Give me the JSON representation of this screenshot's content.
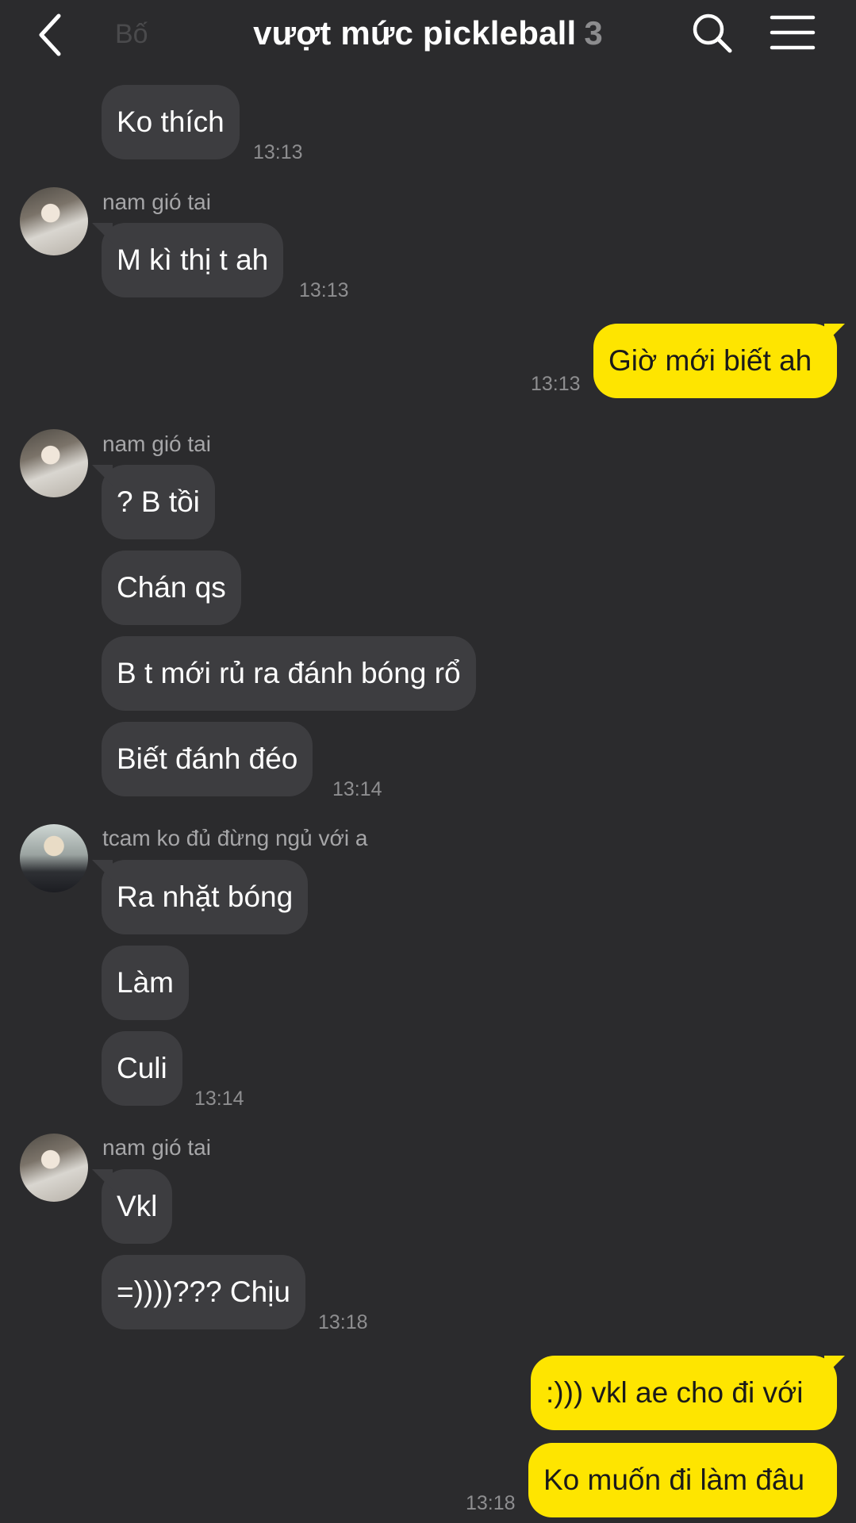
{
  "header": {
    "ghost_name": "Bố",
    "title": "vượt mức pickleball",
    "member_count": "3"
  },
  "colors": {
    "background": "#2b2b2d",
    "incoming_bubble": "#3d3d40",
    "outgoing_bubble": "#fee500"
  },
  "messages": [
    {
      "text": "Ko thích",
      "time": "13:13"
    },
    {
      "sender": "nam gió tai",
      "text": "M kì thị t ah",
      "time": "13:13"
    },
    {
      "text": "Giờ mới biết ah",
      "time": "13:13"
    },
    {
      "sender": "nam gió tai",
      "text": "? B tồi"
    },
    {
      "text": "Chán qs"
    },
    {
      "text": "B t mới rủ ra đánh bóng rổ"
    },
    {
      "text": "Biết đánh đéo",
      "time": "13:14"
    },
    {
      "sender": "tcam ko đủ đừng ngủ với a",
      "text": "Ra nhặt bóng"
    },
    {
      "text": "Làm"
    },
    {
      "text": "Culi",
      "time": "13:14"
    },
    {
      "sender": "nam gió tai",
      "text": "Vkl"
    },
    {
      "text": "=))))??? Chịu",
      "time": "13:18"
    },
    {
      "text": ":))) vkl ae cho đi với"
    },
    {
      "text": "Ko muốn đi làm đâu",
      "time": "13:18"
    }
  ]
}
